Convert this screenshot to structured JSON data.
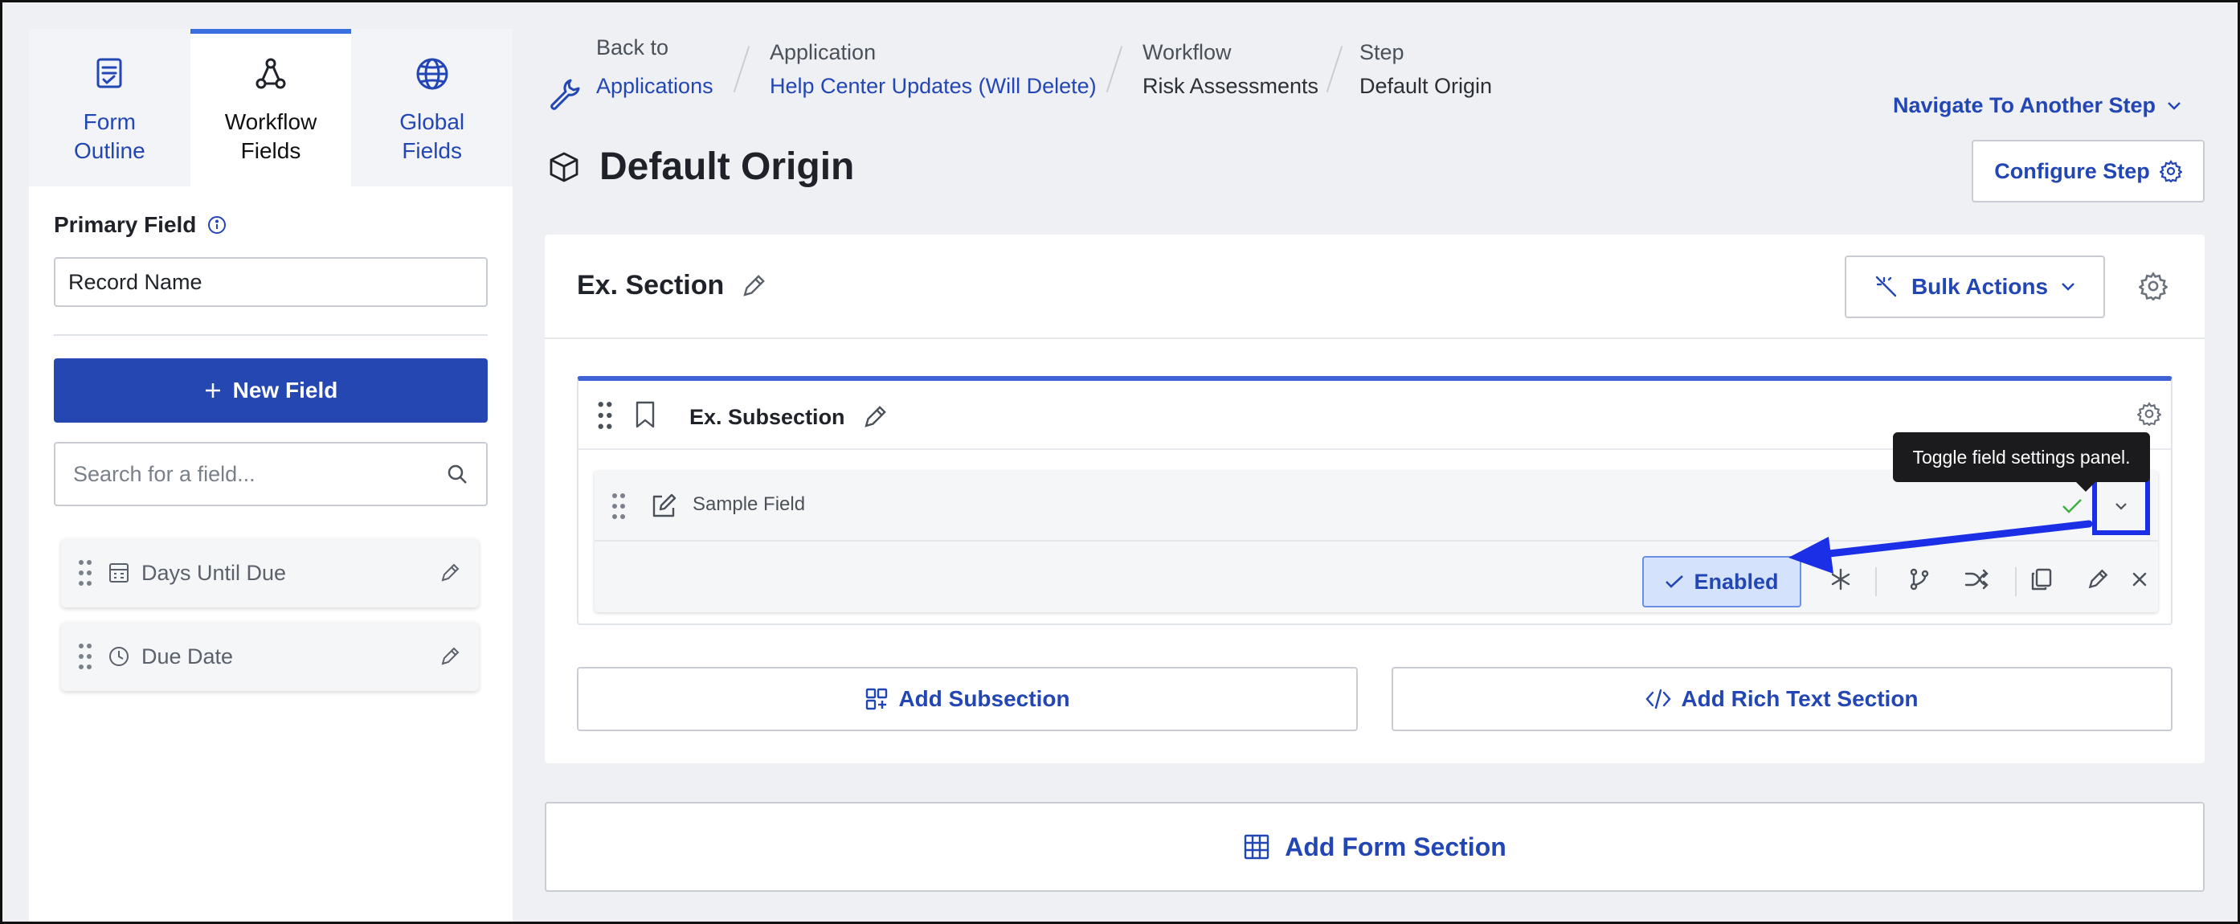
{
  "sidebar": {
    "tabs": [
      {
        "label": "Form Outline",
        "icon": "form-outline-icon"
      },
      {
        "label": "Workflow Fields",
        "icon": "workflow-icon"
      },
      {
        "label": "Global Fields",
        "icon": "globe-icon"
      }
    ],
    "active_tab": "Workflow Fields",
    "primary_field_label": "Primary Field",
    "primary_field_value": "Record Name",
    "new_field_label": "New Field",
    "search_placeholder": "Search for a field...",
    "fields": [
      {
        "name": "Days Until Due",
        "icon": "number-icon"
      },
      {
        "name": "Due Date",
        "icon": "clock-icon"
      }
    ]
  },
  "breadcrumb": {
    "back_label": "Back to",
    "back_link": "Applications",
    "application_label": "Application",
    "application_value": "Help Center Updates (Will Delete)",
    "workflow_label": "Workflow",
    "workflow_value": "Risk Assessments",
    "step_label": "Step",
    "step_value": "Default Origin"
  },
  "header": {
    "navigate_label": "Navigate To Another Step",
    "configure_label": "Configure Step",
    "page_title": "Default Origin"
  },
  "section": {
    "title": "Ex. Section",
    "bulk_actions_label": "Bulk Actions",
    "subsection": {
      "title": "Ex. Subsection",
      "field": {
        "name": "Sample Field",
        "enabled_label": "Enabled",
        "toggle_tooltip": "Toggle field settings panel."
      }
    },
    "add_subsection_label": "Add Subsection",
    "add_rich_text_label": "Add Rich Text Section"
  },
  "add_form_section_label": "Add Form Section",
  "colors": {
    "accent": "#2447b2",
    "link": "#2346b5",
    "highlight": "#1a2fe6",
    "enabled_bg": "#d5e2fb",
    "check": "#3cb043"
  }
}
